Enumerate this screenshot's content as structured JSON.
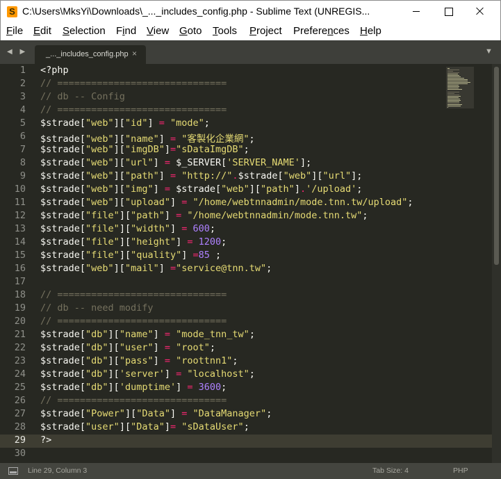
{
  "window": {
    "title": "C:\\Users\\MksYi\\Downloads\\_..._includes_config.php - Sublime Text (UNREGIS..."
  },
  "menu": {
    "items": [
      {
        "label": "File",
        "u": "F",
        "rest": "ile"
      },
      {
        "label": "Edit",
        "u": "E",
        "rest": "dit"
      },
      {
        "label": "Selection",
        "u": "S",
        "rest": "election"
      },
      {
        "label": "Find",
        "pre": "F",
        "u": "i",
        "rest": "nd"
      },
      {
        "label": "View",
        "u": "V",
        "rest": "iew"
      },
      {
        "label": "Goto",
        "u": "G",
        "rest": "oto"
      },
      {
        "label": "Tools",
        "u": "T",
        "rest": "ools"
      },
      {
        "label": "Project",
        "u": "P",
        "rest": "roject"
      },
      {
        "label": "Preferences",
        "pre": "Prefere",
        "u": "n",
        "rest": "ces"
      },
      {
        "label": "Help",
        "u": "H",
        "rest": "elp"
      }
    ]
  },
  "tabs": {
    "active_label": "_..._includes_config.php",
    "close_glyph": "×",
    "nav_glyph": "◀ ▶",
    "overflow_glyph": "▼"
  },
  "editor": {
    "active_line": 29,
    "colors": {
      "background": "#272822",
      "plain": "#f8f8f2",
      "string": "#e6db74",
      "operator": "#f92672",
      "number": "#ae81ff",
      "comment": "#75715e"
    },
    "lines": [
      [
        [
          "plain",
          "<?php"
        ]
      ],
      [
        [
          "com",
          "// =============================="
        ]
      ],
      [
        [
          "com",
          "// db -- Config"
        ]
      ],
      [
        [
          "com",
          "// =============================="
        ]
      ],
      [
        [
          "plain",
          "$strade["
        ],
        [
          "str",
          "\"web\""
        ],
        [
          "plain",
          "]["
        ],
        [
          "str",
          "\"id\""
        ],
        [
          "plain",
          "] "
        ],
        [
          "op",
          "="
        ],
        [
          "plain",
          " "
        ],
        [
          "str",
          "\"mode\""
        ],
        [
          "plain",
          ";"
        ]
      ],
      [
        [
          "plain",
          "$strade["
        ],
        [
          "str",
          "\"web\""
        ],
        [
          "plain",
          "]["
        ],
        [
          "str",
          "\"name\""
        ],
        [
          "plain",
          "] "
        ],
        [
          "op",
          "="
        ],
        [
          "plain",
          " "
        ],
        [
          "str",
          "\"客製化企業網\""
        ],
        [
          "plain",
          ";"
        ]
      ],
      [
        [
          "plain",
          "$strade["
        ],
        [
          "str",
          "\"web\""
        ],
        [
          "plain",
          "]["
        ],
        [
          "str",
          "\"imgDB\""
        ],
        [
          "plain",
          "]"
        ],
        [
          "op",
          "="
        ],
        [
          "str",
          "\"sDataImgDB\""
        ],
        [
          "plain",
          ";"
        ]
      ],
      [
        [
          "plain",
          "$strade["
        ],
        [
          "str",
          "\"web\""
        ],
        [
          "plain",
          "]["
        ],
        [
          "str",
          "\"url\""
        ],
        [
          "plain",
          "] "
        ],
        [
          "op",
          "="
        ],
        [
          "plain",
          " $_SERVER["
        ],
        [
          "str",
          "'SERVER_NAME'"
        ],
        [
          "plain",
          "];"
        ]
      ],
      [
        [
          "plain",
          "$strade["
        ],
        [
          "str",
          "\"web\""
        ],
        [
          "plain",
          "]["
        ],
        [
          "str",
          "\"path\""
        ],
        [
          "plain",
          "] "
        ],
        [
          "op",
          "="
        ],
        [
          "plain",
          " "
        ],
        [
          "str",
          "\"http://\""
        ],
        [
          "op",
          "."
        ],
        [
          "plain",
          "$strade["
        ],
        [
          "str",
          "\"web\""
        ],
        [
          "plain",
          "]["
        ],
        [
          "str",
          "\"url\""
        ],
        [
          "plain",
          "];"
        ]
      ],
      [
        [
          "plain",
          "$strade["
        ],
        [
          "str",
          "\"web\""
        ],
        [
          "plain",
          "]["
        ],
        [
          "str",
          "\"img\""
        ],
        [
          "plain",
          "] "
        ],
        [
          "op",
          "="
        ],
        [
          "plain",
          " $strade["
        ],
        [
          "str",
          "\"web\""
        ],
        [
          "plain",
          "]["
        ],
        [
          "str",
          "\"path\""
        ],
        [
          "plain",
          "]"
        ],
        [
          "op",
          "."
        ],
        [
          "str",
          "'/upload'"
        ],
        [
          "plain",
          ";"
        ]
      ],
      [
        [
          "plain",
          "$strade["
        ],
        [
          "str",
          "\"web\""
        ],
        [
          "plain",
          "]["
        ],
        [
          "str",
          "\"upload\""
        ],
        [
          "plain",
          "] "
        ],
        [
          "op",
          "="
        ],
        [
          "plain",
          " "
        ],
        [
          "str",
          "\"/home/webtnnadmin/mode.tnn.tw/upload\""
        ],
        [
          "plain",
          ";"
        ]
      ],
      [
        [
          "plain",
          "$strade["
        ],
        [
          "str",
          "\"file\""
        ],
        [
          "plain",
          "]["
        ],
        [
          "str",
          "\"path\""
        ],
        [
          "plain",
          "] "
        ],
        [
          "op",
          "="
        ],
        [
          "plain",
          " "
        ],
        [
          "str",
          "\"/home/webtnnadmin/mode.tnn.tw\""
        ],
        [
          "plain",
          ";"
        ]
      ],
      [
        [
          "plain",
          "$strade["
        ],
        [
          "str",
          "\"file\""
        ],
        [
          "plain",
          "]["
        ],
        [
          "str",
          "\"width\""
        ],
        [
          "plain",
          "] "
        ],
        [
          "op",
          "="
        ],
        [
          "plain",
          " "
        ],
        [
          "num",
          "600"
        ],
        [
          "plain",
          ";"
        ]
      ],
      [
        [
          "plain",
          "$strade["
        ],
        [
          "str",
          "\"file\""
        ],
        [
          "plain",
          "]["
        ],
        [
          "str",
          "\"height\""
        ],
        [
          "plain",
          "] "
        ],
        [
          "op",
          "="
        ],
        [
          "plain",
          " "
        ],
        [
          "num",
          "1200"
        ],
        [
          "plain",
          ";"
        ]
      ],
      [
        [
          "plain",
          "$strade["
        ],
        [
          "str",
          "\"file\""
        ],
        [
          "plain",
          "]["
        ],
        [
          "str",
          "\"quality\""
        ],
        [
          "plain",
          "] "
        ],
        [
          "op",
          "="
        ],
        [
          "num",
          "85"
        ],
        [
          "plain",
          " ;"
        ]
      ],
      [
        [
          "plain",
          "$strade["
        ],
        [
          "str",
          "\"web\""
        ],
        [
          "plain",
          "]["
        ],
        [
          "str",
          "\"mail\""
        ],
        [
          "plain",
          "] "
        ],
        [
          "op",
          "="
        ],
        [
          "str",
          "\"service@tnn.tw\""
        ],
        [
          "plain",
          ";"
        ]
      ],
      [],
      [
        [
          "com",
          "// =============================="
        ]
      ],
      [
        [
          "com",
          "// db -- need modify"
        ]
      ],
      [
        [
          "com",
          "// =============================="
        ]
      ],
      [
        [
          "plain",
          "$strade["
        ],
        [
          "str",
          "\"db\""
        ],
        [
          "plain",
          "]["
        ],
        [
          "str",
          "\"name\""
        ],
        [
          "plain",
          "] "
        ],
        [
          "op",
          "="
        ],
        [
          "plain",
          " "
        ],
        [
          "str",
          "\"mode_tnn_tw\""
        ],
        [
          "plain",
          ";"
        ]
      ],
      [
        [
          "plain",
          "$strade["
        ],
        [
          "str",
          "\"db\""
        ],
        [
          "plain",
          "]["
        ],
        [
          "str",
          "\"user\""
        ],
        [
          "plain",
          "] "
        ],
        [
          "op",
          "="
        ],
        [
          "plain",
          " "
        ],
        [
          "str",
          "\"root\""
        ],
        [
          "plain",
          ";"
        ]
      ],
      [
        [
          "plain",
          "$strade["
        ],
        [
          "str",
          "\"db\""
        ],
        [
          "plain",
          "]["
        ],
        [
          "str",
          "\"pass\""
        ],
        [
          "plain",
          "] "
        ],
        [
          "op",
          "="
        ],
        [
          "plain",
          " "
        ],
        [
          "str",
          "\"roottnn1\""
        ],
        [
          "plain",
          ";"
        ]
      ],
      [
        [
          "plain",
          "$strade["
        ],
        [
          "str",
          "\"db\""
        ],
        [
          "plain",
          "]["
        ],
        [
          "str",
          "'server'"
        ],
        [
          "plain",
          "] "
        ],
        [
          "op",
          "="
        ],
        [
          "plain",
          " "
        ],
        [
          "str",
          "\"localhost\""
        ],
        [
          "plain",
          ";"
        ]
      ],
      [
        [
          "plain",
          "$strade["
        ],
        [
          "str",
          "\"db\""
        ],
        [
          "plain",
          "]["
        ],
        [
          "str",
          "'dumptime'"
        ],
        [
          "plain",
          "] "
        ],
        [
          "op",
          "="
        ],
        [
          "plain",
          " "
        ],
        [
          "num",
          "3600"
        ],
        [
          "plain",
          ";"
        ]
      ],
      [
        [
          "com",
          "// =============================="
        ]
      ],
      [
        [
          "plain",
          "$strade["
        ],
        [
          "str",
          "\"Power\""
        ],
        [
          "plain",
          "]["
        ],
        [
          "str",
          "\"Data\""
        ],
        [
          "plain",
          "] "
        ],
        [
          "op",
          "="
        ],
        [
          "plain",
          " "
        ],
        [
          "str",
          "\"DataManager\""
        ],
        [
          "plain",
          ";"
        ]
      ],
      [
        [
          "plain",
          "$strade["
        ],
        [
          "str",
          "\"user\""
        ],
        [
          "plain",
          "]["
        ],
        [
          "str",
          "\"Data\""
        ],
        [
          "plain",
          "]"
        ],
        [
          "op",
          "="
        ],
        [
          "plain",
          " "
        ],
        [
          "str",
          "\"sDataUser\""
        ],
        [
          "plain",
          ";"
        ]
      ],
      [
        [
          "plain",
          "?>"
        ]
      ],
      []
    ]
  },
  "status": {
    "position": "Line 29, Column 3",
    "tab_size": "Tab Size: 4",
    "syntax": "PHP"
  }
}
